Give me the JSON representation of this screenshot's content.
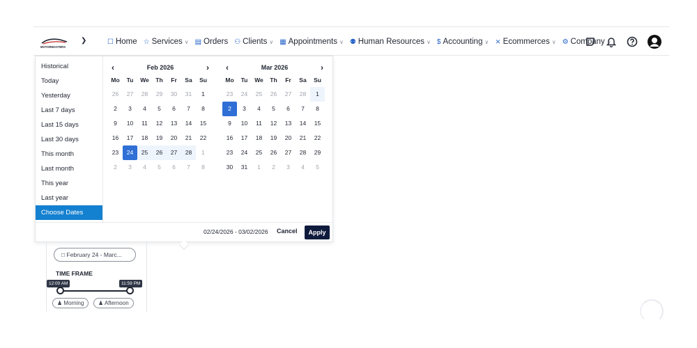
{
  "brand": {
    "logo_text": "MOTORMASTERS"
  },
  "nav": [
    {
      "icon": "chat-icon",
      "label": "Home",
      "caret": false
    },
    {
      "icon": "star-icon",
      "label": "Services",
      "caret": true
    },
    {
      "icon": "receipt-icon",
      "label": "Orders",
      "caret": false
    },
    {
      "icon": "users-icon",
      "label": "Clients",
      "caret": true
    },
    {
      "icon": "calendar-icon",
      "label": "Appointments",
      "caret": true
    },
    {
      "icon": "people-icon",
      "label": "Human Resources",
      "caret": true
    },
    {
      "icon": "dollar-icon",
      "label": "Accounting",
      "caret": true
    },
    {
      "icon": "cart-icon",
      "label": "Ecommerces",
      "caret": true
    },
    {
      "icon": "gear-icon",
      "label": "Company",
      "caret": true
    }
  ],
  "presets": [
    "Historical",
    "Today",
    "Yesterday",
    "Last 7 days",
    "Last 15 days",
    "Last 30 days",
    "This month",
    "Last month",
    "This year",
    "Last year",
    "Choose Dates"
  ],
  "active_preset": "Choose Dates",
  "weekdays": [
    "Mo",
    "Tu",
    "We",
    "Th",
    "Fr",
    "Sa",
    "Su"
  ],
  "calendars": [
    {
      "title": "Feb 2026",
      "days": [
        [
          "26",
          "m"
        ],
        [
          "27",
          "m"
        ],
        [
          "28",
          "m"
        ],
        [
          "29",
          "m"
        ],
        [
          "30",
          "m"
        ],
        [
          "31",
          "m"
        ],
        [
          "1",
          ""
        ],
        [
          "2",
          ""
        ],
        [
          "3",
          ""
        ],
        [
          "4",
          ""
        ],
        [
          "5",
          ""
        ],
        [
          "6",
          ""
        ],
        [
          "7",
          ""
        ],
        [
          "8",
          ""
        ],
        [
          "9",
          ""
        ],
        [
          "10",
          ""
        ],
        [
          "11",
          ""
        ],
        [
          "12",
          ""
        ],
        [
          "13",
          ""
        ],
        [
          "14",
          ""
        ],
        [
          "15",
          ""
        ],
        [
          "16",
          ""
        ],
        [
          "17",
          ""
        ],
        [
          "18",
          ""
        ],
        [
          "19",
          ""
        ],
        [
          "20",
          ""
        ],
        [
          "21",
          ""
        ],
        [
          "22",
          ""
        ],
        [
          "23",
          ""
        ],
        [
          "24",
          "s"
        ],
        [
          "25",
          "r"
        ],
        [
          "26",
          "r"
        ],
        [
          "27",
          "r"
        ],
        [
          "28",
          "r"
        ],
        [
          "1",
          "m"
        ],
        [
          "2",
          "m"
        ],
        [
          "3",
          "m"
        ],
        [
          "4",
          "m"
        ],
        [
          "5",
          "m"
        ],
        [
          "6",
          "m"
        ],
        [
          "7",
          "m"
        ],
        [
          "8",
          "m"
        ]
      ]
    },
    {
      "title": "Mar 2026",
      "days": [
        [
          "23",
          "m"
        ],
        [
          "24",
          "m"
        ],
        [
          "25",
          "m"
        ],
        [
          "26",
          "m"
        ],
        [
          "27",
          "m"
        ],
        [
          "28",
          "m"
        ],
        [
          "1",
          "r"
        ],
        [
          "2",
          "s"
        ],
        [
          "3",
          ""
        ],
        [
          "4",
          ""
        ],
        [
          "5",
          ""
        ],
        [
          "6",
          ""
        ],
        [
          "7",
          ""
        ],
        [
          "8",
          ""
        ],
        [
          "9",
          ""
        ],
        [
          "10",
          ""
        ],
        [
          "11",
          ""
        ],
        [
          "12",
          ""
        ],
        [
          "13",
          ""
        ],
        [
          "14",
          ""
        ],
        [
          "15",
          ""
        ],
        [
          "16",
          ""
        ],
        [
          "17",
          ""
        ],
        [
          "18",
          ""
        ],
        [
          "19",
          ""
        ],
        [
          "20",
          ""
        ],
        [
          "21",
          ""
        ],
        [
          "22",
          ""
        ],
        [
          "23",
          ""
        ],
        [
          "24",
          ""
        ],
        [
          "25",
          ""
        ],
        [
          "26",
          ""
        ],
        [
          "27",
          ""
        ],
        [
          "28",
          ""
        ],
        [
          "29",
          ""
        ],
        [
          "30",
          ""
        ],
        [
          "31",
          ""
        ],
        [
          "1",
          "m"
        ],
        [
          "2",
          "m"
        ],
        [
          "3",
          "m"
        ],
        [
          "4",
          "m"
        ],
        [
          "5",
          "m"
        ]
      ]
    }
  ],
  "footer": {
    "range": "02/24/2026 - 03/02/2026",
    "cancel": "Cancel",
    "apply": "Apply"
  },
  "filter": {
    "date_pill": "February 24 - Marc...",
    "time_frame_label": "TIME FRAME",
    "start_time": "12:00 AM",
    "end_time": "11:59 PM",
    "periods": [
      "Morning",
      "Afternoon"
    ]
  },
  "colors": {
    "accent": "#1480d0",
    "selected": "#2f6fd6",
    "range": "#eef4fb",
    "apply_bg": "#0f1b3d",
    "nav_icon": "#2563c9"
  }
}
